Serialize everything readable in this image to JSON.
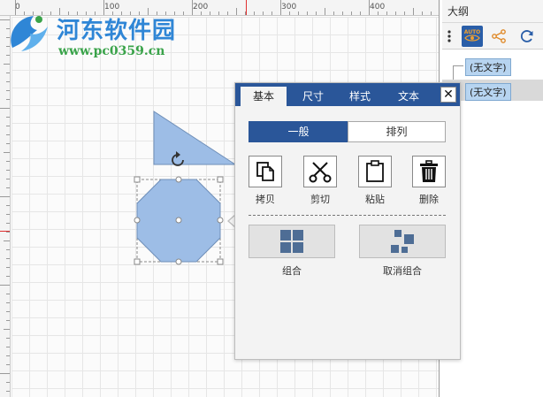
{
  "ruler": {
    "labels": [
      "0",
      "100",
      "200",
      "300",
      "400"
    ]
  },
  "watermark": {
    "title": "河东软件园",
    "url": "www.pc0359.cn"
  },
  "outline": {
    "title": "大纲",
    "tools": [
      {
        "icon": "more-vertical-icon"
      },
      {
        "icon": "auto-eye-icon",
        "label": "AUTO",
        "active": true
      },
      {
        "icon": "share-icon"
      },
      {
        "icon": "refresh-icon"
      }
    ],
    "items": [
      {
        "label": "(无文字)",
        "selected": false
      },
      {
        "label": "(无文字)",
        "selected": true
      }
    ]
  },
  "popup": {
    "tabs": [
      {
        "label": "基本",
        "active": true
      },
      {
        "label": "尺寸",
        "active": false
      },
      {
        "label": "样式",
        "active": false
      },
      {
        "label": "文本",
        "active": false
      }
    ],
    "close_icon": "close-icon",
    "segments": [
      {
        "label": "一般",
        "active": true
      },
      {
        "label": "排列",
        "active": false
      }
    ],
    "actions": [
      {
        "label": "拷贝",
        "icon": "copy-icon"
      },
      {
        "label": "剪切",
        "icon": "scissors-icon"
      },
      {
        "label": "粘贴",
        "icon": "clipboard-icon"
      },
      {
        "label": "删除",
        "icon": "trash-icon"
      }
    ],
    "group_actions": [
      {
        "label": "组合",
        "icon": "group-icon"
      },
      {
        "label": "取消组合",
        "icon": "ungroup-icon"
      }
    ]
  },
  "colors": {
    "accent": "#2a5699",
    "shape_fill": "#9dbde6",
    "shape_stroke": "#6f8fb8",
    "logo_blue": "#2f86d6",
    "logo_green": "#3aa34a"
  }
}
